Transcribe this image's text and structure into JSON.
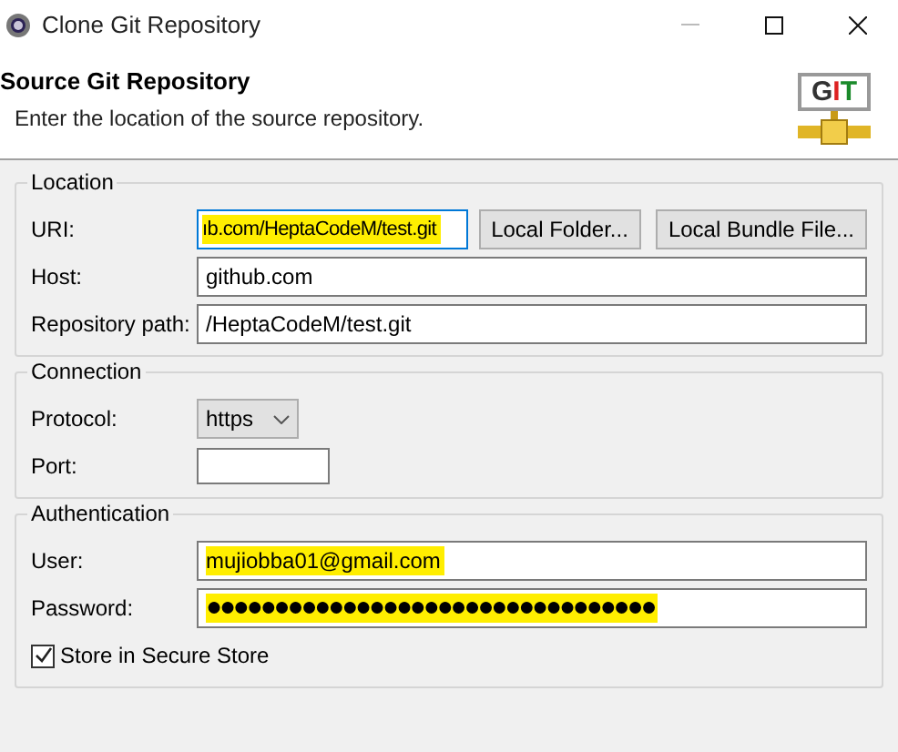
{
  "window": {
    "title": "Clone Git Repository"
  },
  "header": {
    "title": "Source Git Repository",
    "description": "Enter the location of the source repository.",
    "logo_text": "GIT"
  },
  "location": {
    "title": "Location",
    "uri": {
      "label": "URI:",
      "value": "ıb.com/HeptaCodeM/test.git",
      "highlighted": true,
      "focused": true
    },
    "buttons": [
      "Local Folder...",
      "Local Bundle File..."
    ],
    "host": {
      "label": "Host:",
      "value": "github.com",
      "highlighted": false
    },
    "path": {
      "label": "Repository path:",
      "value": "/HeptaCodeM/test.git",
      "highlighted": false
    }
  },
  "connection": {
    "title": "Connection",
    "protocol": {
      "label": "Protocol:",
      "value": "https"
    },
    "port": {
      "label": "Port:"
    }
  },
  "authentication": {
    "title": "Authentication",
    "user": {
      "label": "User:",
      "value": "mujiobba01@gmail.com",
      "highlighted": true
    },
    "password": {
      "label": "Password:",
      "value": "●●●●●●●●●●●●●●●●●●●●●●●●●●●●●●●●●",
      "highlighted": true
    },
    "store": {
      "label": "Store in Secure Store",
      "checked": true
    }
  }
}
